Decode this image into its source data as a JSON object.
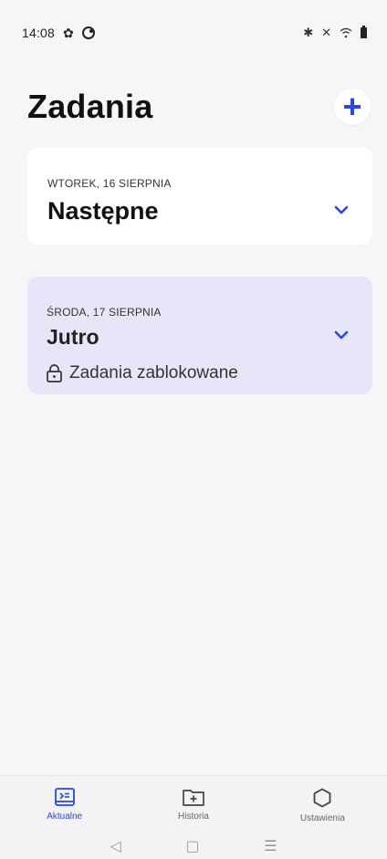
{
  "status_bar": {
    "time": "14:08",
    "icons_left": [
      "gear-icon",
      "round-icon"
    ],
    "icons_right": [
      "bluetooth-icon",
      "mute-icon",
      "wifi-icon",
      "battery-icon"
    ]
  },
  "header": {
    "title": "Zadania",
    "add_label": "+",
    "accent": "#2a45e8"
  },
  "cards": [
    {
      "date": "WTOREK, 16 SIERPNIA",
      "title": "Następne",
      "background": "#ffffff"
    },
    {
      "date": "ŚRODA, 17 SIERPNIA",
      "title": "Jutro",
      "status": "Zadania zablokowane",
      "status_icon": "lock-icon",
      "background": "#e6e6f8"
    }
  ],
  "bottom_nav": [
    {
      "label": "Aktualne",
      "icon": "calendar-icon",
      "active": true
    },
    {
      "label": "Historia",
      "icon": "folder-add-icon",
      "active": false
    },
    {
      "label": "Ustawienia",
      "icon": "hexagon-icon",
      "active": false
    }
  ],
  "system_nav": {
    "back": "◁",
    "home": "▢",
    "recents": "☰"
  }
}
